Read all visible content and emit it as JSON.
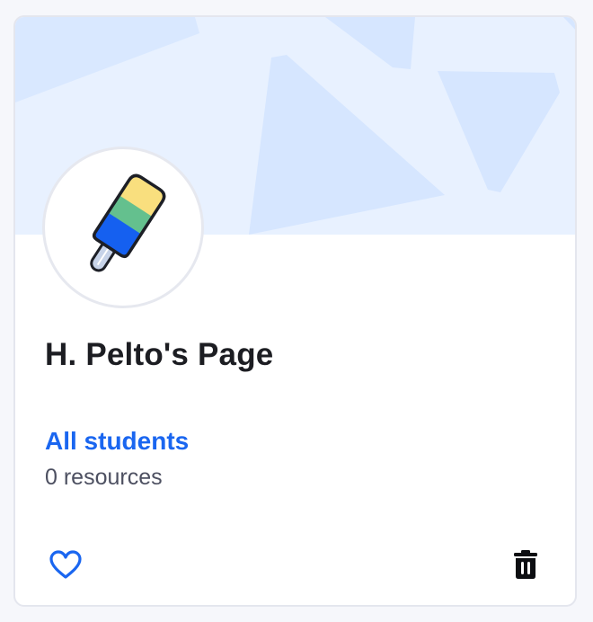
{
  "page": {
    "title": "H. Pelto's Page",
    "audience_label": "All students",
    "resource_count": "0 resources"
  },
  "icons": {
    "avatar": "popsicle-icon",
    "favorite": "heart-icon",
    "delete": "trash-icon"
  },
  "colors": {
    "accent": "#1a66f0",
    "banner": "#e8f1ff",
    "banner_shapes": "#d6e6ff",
    "popsicle_top": "#f9df7e",
    "popsicle_middle": "#64c08e",
    "popsicle_bottom": "#1560f0"
  }
}
